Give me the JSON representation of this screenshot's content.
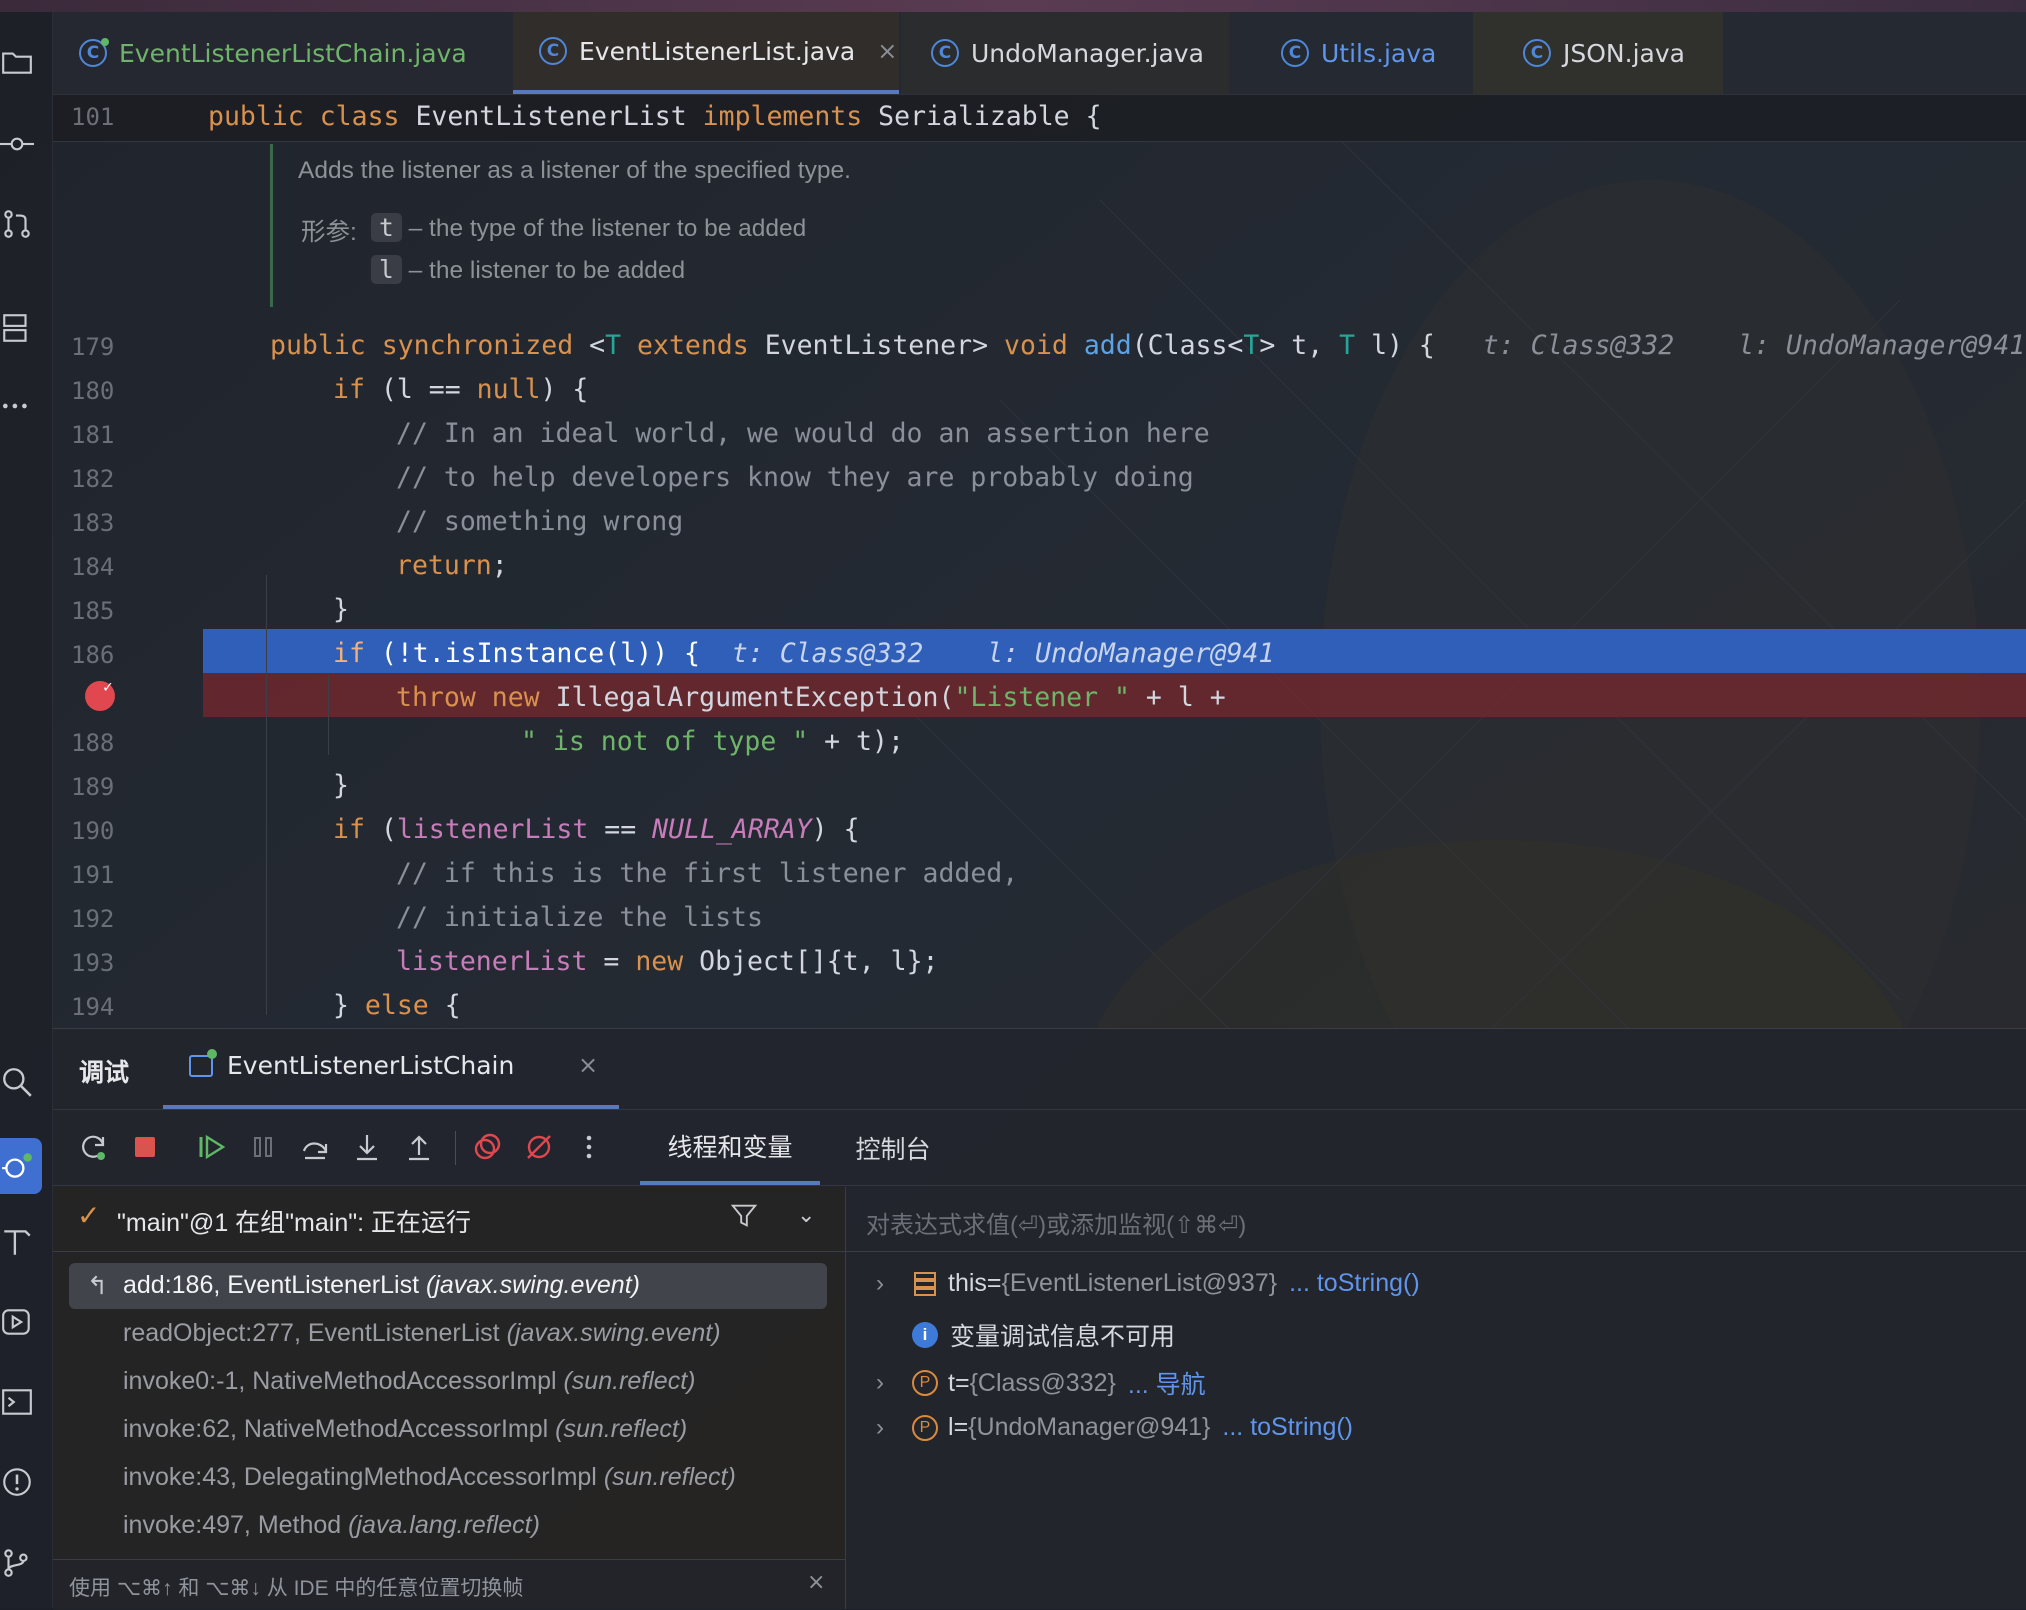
{
  "tabs": [
    {
      "label": "EventListenerListChain.java"
    },
    {
      "label": "EventListenerList.java",
      "close": "×"
    },
    {
      "label": "UndoManager.java"
    },
    {
      "label": "Utils.java"
    },
    {
      "label": "JSON.java"
    }
  ],
  "editor": {
    "sticky": {
      "line": "101",
      "kw1": "public",
      "kw2": "class",
      "name": "EventListenerList",
      "kw3": "implements",
      "iface": "Serializable {"
    },
    "doc": {
      "summary": "Adds the listener as a listener of the specified type.",
      "params_label": "形参:",
      "p1_name": "t",
      "p1_desc": "– the type of the listener to be added",
      "p2_name": "l",
      "p2_desc": "– the listener to be added"
    },
    "line_numbers": [
      "179",
      "180",
      "181",
      "182",
      "183",
      "184",
      "185",
      "186",
      "",
      "188",
      "189",
      "190",
      "191",
      "192",
      "193",
      "194"
    ],
    "line179": {
      "kw1": "public",
      "kw2": "synchronized",
      "lt": "<",
      "T": "T",
      "kw3": "extends",
      "ev": "EventListener>",
      "kw4": "void",
      "fn": "add",
      "args1": "(Class<",
      "T2": "T",
      "args2": "> t, ",
      "T3": "T",
      "args3": " l) {",
      "hint1": "t: Class@332",
      "hint2": "l: UndoManager@941"
    },
    "line180": {
      "kw": "if",
      "rest": " (l == ",
      "nul": "null",
      "end": ") {"
    },
    "line181": "// In an ideal world, we would do an assertion here",
    "line182": "// to help developers know they are probably doing",
    "line183": "// something wrong",
    "line184": {
      "kw": "return",
      "end": ";"
    },
    "line185": "}",
    "line186": {
      "kw": "if",
      "rest": " (!t.isInstance(l)) {",
      "hint1": "t: Class@332",
      "hint2": "l: UndoManager@941"
    },
    "line187": {
      "kw1": "throw",
      "kw2": "new",
      "cls": " IllegalArgumentException(",
      "str": "\"Listener \"",
      "rest": " + l +"
    },
    "line188": {
      "str": "\" is not of type \"",
      "rest": " + t);"
    },
    "line189": "}",
    "line190": {
      "kw": "if",
      "rest1": " (",
      "fld": "listenerList",
      "rest2": " == ",
      "cst": "NULL_ARRAY",
      "rest3": ") {"
    },
    "line191": "// if this is the first listener added,",
    "line192": "// initialize the lists",
    "line193": {
      "fld": "listenerList",
      "rest1": " = ",
      "kw": "new",
      "rest2": " Object[]{t, l};"
    },
    "line194": {
      "rest1": "} ",
      "kw": "else",
      "rest2": " {"
    }
  },
  "debug": {
    "title": "调试",
    "session_tab": "EventListenerListChain",
    "session_close": "×",
    "subtab_threads": "线程和变量",
    "subtab_console": "控制台",
    "thread_status": "\"main\"@1 在组\"main\": 正在运行",
    "frames": [
      {
        "loc": "add:186, EventListenerList",
        "pkg": "(javax.swing.event)"
      },
      {
        "loc": "readObject:277, EventListenerList",
        "pkg": "(javax.swing.event)"
      },
      {
        "loc": "invoke0:-1, NativeMethodAccessorImpl",
        "pkg": "(sun.reflect)"
      },
      {
        "loc": "invoke:62, NativeMethodAccessorImpl",
        "pkg": "(sun.reflect)"
      },
      {
        "loc": "invoke:43, DelegatingMethodAccessorImpl",
        "pkg": "(sun.reflect)"
      },
      {
        "loc": "invoke:497, Method",
        "pkg": "(java.lang.reflect)"
      }
    ],
    "frames_hint": "使用 ⌥⌘↑ 和 ⌥⌘↓ 从 IDE 中的任意位置切换帧",
    "frames_hint_close": "×",
    "eval_placeholder": "对表达式求值(⏎)或添加监视(⇧⌘⏎)",
    "vars": [
      {
        "name": "this",
        "eq": " = ",
        "value": "{EventListenerList@937}",
        "action": "... toString()"
      },
      {
        "info": "变量调试信息不可用"
      },
      {
        "name": "t",
        "eq": " = ",
        "value": "{Class@332}",
        "action": "... 导航"
      },
      {
        "name": "l",
        "eq": " = ",
        "value": "{UndoManager@941}",
        "action": "... toString()"
      }
    ],
    "param_badge": "P",
    "info_badge": "i"
  },
  "colors": {
    "accent": "#2f5fb8",
    "breakpoint": "#e0474f",
    "link": "#5f95ec",
    "keyword": "#d9914e"
  }
}
